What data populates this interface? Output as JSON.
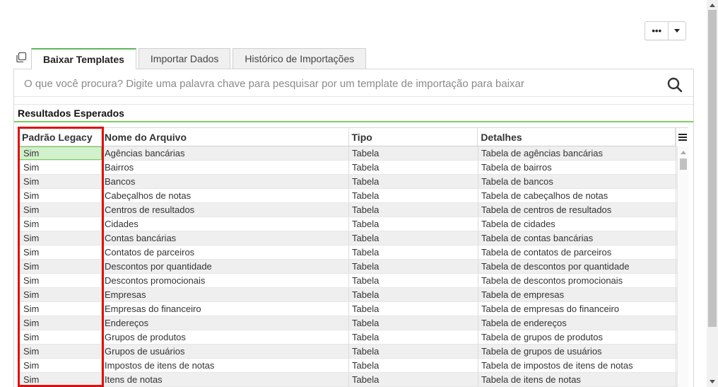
{
  "toolbar": {
    "more_label": "•••",
    "more_icon": "ellipsis-icon",
    "caret_icon": "chevron-down-icon"
  },
  "tabs": [
    {
      "label": "Baixar Templates",
      "active": true
    },
    {
      "label": "Importar Dados",
      "active": false
    },
    {
      "label": "Histórico de Importações",
      "active": false
    }
  ],
  "search": {
    "placeholder": "O que você procura? Digite uma palavra chave para pesquisar por um template de importação para baixar",
    "value": "",
    "icon": "search-icon"
  },
  "results": {
    "title": "Resultados Esperados"
  },
  "grid": {
    "columns": [
      "Padrão Legacy",
      "Nome do Arquivo",
      "Tipo",
      "Detalhes"
    ],
    "rows": [
      [
        "Sim",
        "Agências bancárias",
        "Tabela",
        "Tabela de agências bancárias"
      ],
      [
        "Sim",
        "Bairros",
        "Tabela",
        "Tabela de bairros"
      ],
      [
        "Sim",
        "Bancos",
        "Tabela",
        "Tabela de bancos"
      ],
      [
        "Sim",
        "Cabeçalhos de notas",
        "Tabela",
        "Tabela de cabeçalhos de notas"
      ],
      [
        "Sim",
        "Centros de resultados",
        "Tabela",
        "Tabela de centros de resultados"
      ],
      [
        "Sim",
        "Cidades",
        "Tabela",
        "Tabela de cidades"
      ],
      [
        "Sim",
        "Contas bancárias",
        "Tabela",
        "Tabela de contas bancárias"
      ],
      [
        "Sim",
        "Contatos de parceiros",
        "Tabela",
        "Tabela de contatos de parceiros"
      ],
      [
        "Sim",
        "Descontos por quantidade",
        "Tabela",
        "Tabela de descontos por quantidade"
      ],
      [
        "Sim",
        "Descontos promocionais",
        "Tabela",
        "Tabela de descontos promocionais"
      ],
      [
        "Sim",
        "Empresas",
        "Tabela",
        "Tabela de empresas"
      ],
      [
        "Sim",
        "Empresas do financeiro",
        "Tabela",
        "Tabela de empresas do financeiro"
      ],
      [
        "Sim",
        "Endereços",
        "Tabela",
        "Tabela de endereços"
      ],
      [
        "Sim",
        "Grupos de produtos",
        "Tabela",
        "Tabela de grupos de produtos"
      ],
      [
        "Sim",
        "Grupos de usuários",
        "Tabela",
        "Tabela de grupos de usuários"
      ],
      [
        "Sim",
        "Impostos de itens de notas",
        "Tabela",
        "Tabela de impostos de itens de notas"
      ],
      [
        "Sim",
        "Itens de notas",
        "Tabela",
        "Tabela de itens de notas"
      ]
    ],
    "selected_row": 0
  },
  "colors": {
    "accent": "#5cb85c",
    "highlight": "#e01010",
    "selected_cell": "#d1f0cc"
  }
}
